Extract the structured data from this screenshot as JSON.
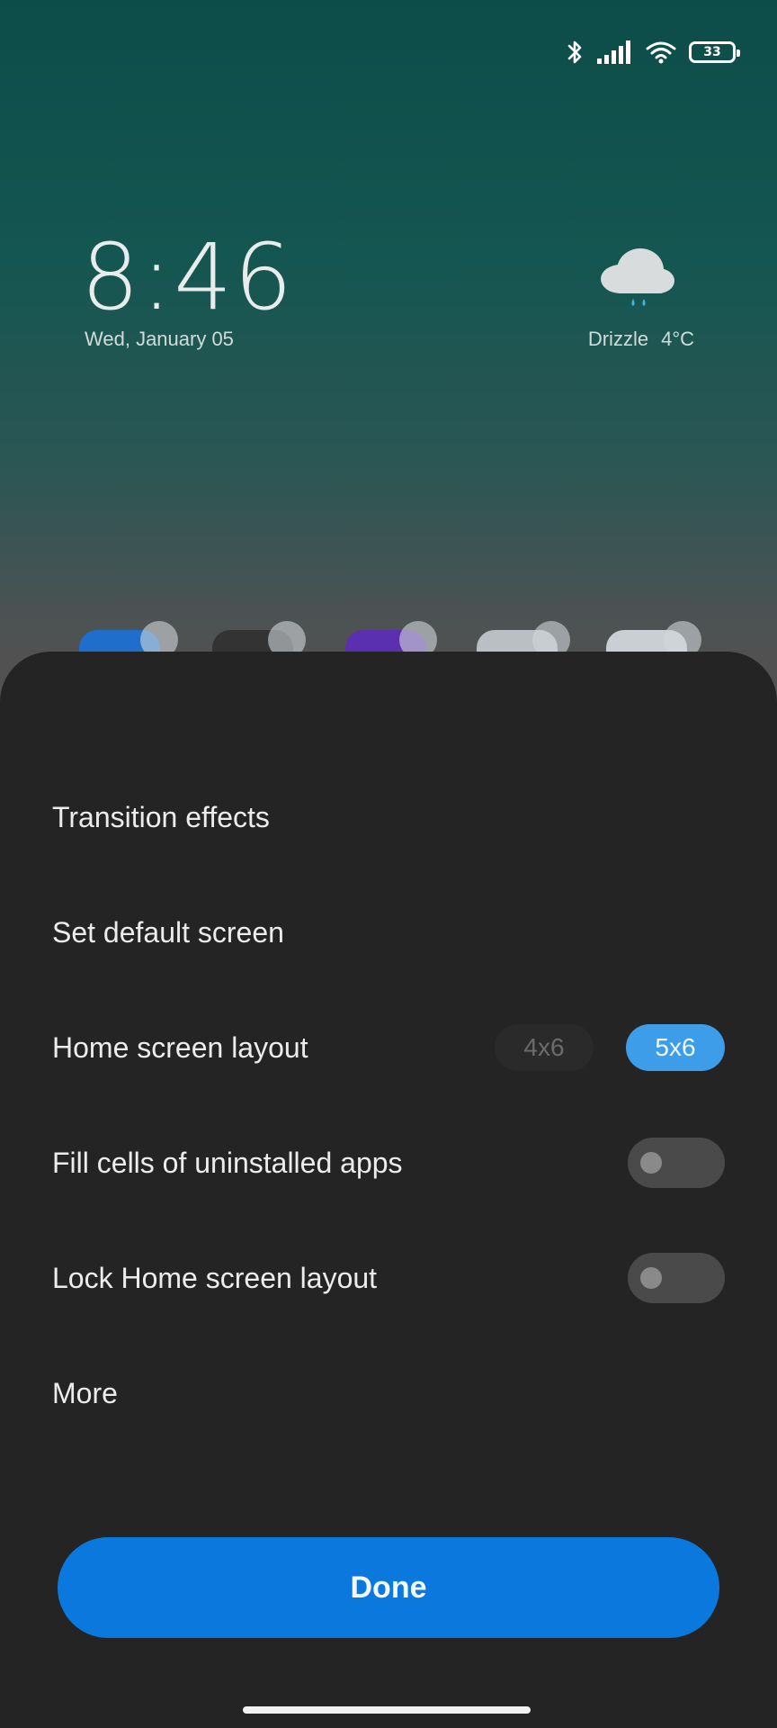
{
  "status_bar": {
    "battery_level": "33",
    "icons": [
      "bluetooth-icon",
      "signal-icon",
      "wifi-icon",
      "battery-icon"
    ]
  },
  "lockscreen": {
    "time": "8:46",
    "date": "Wed, January 05"
  },
  "weather": {
    "condition": "Drizzle",
    "temperature": "4°C",
    "icon": "cloud-drizzle-icon"
  },
  "settings": {
    "transition_effects": "Transition effects",
    "set_default_screen": "Set default screen",
    "home_screen_layout": {
      "label": "Home screen layout",
      "options": [
        "4x6",
        "5x6"
      ],
      "selected": "5x6"
    },
    "fill_cells": {
      "label": "Fill cells of uninstalled apps",
      "enabled": false
    },
    "lock_layout": {
      "label": "Lock Home screen layout",
      "enabled": false
    },
    "more": "More"
  },
  "done_button": "Done",
  "colors": {
    "accent": "#0b78dd",
    "selected_option": "#3e9de8",
    "sheet": "#242424"
  }
}
